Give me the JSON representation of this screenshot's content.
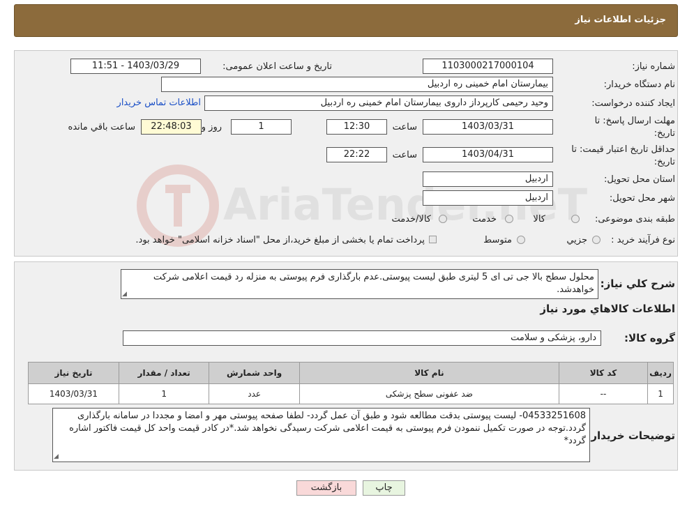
{
  "header": {
    "title": "جزئیات اطلاعات نیاز"
  },
  "need_number": {
    "label": "شماره نیاز:",
    "value": "1103000217000104"
  },
  "announce": {
    "label": "تاریخ و ساعت اعلان عمومی:",
    "value": "1403/03/29 - 11:51"
  },
  "buyer_org": {
    "label": "نام دستگاه خریدار:",
    "value": "بیمارستان امام خمینی  ره  اردبیل"
  },
  "creator": {
    "label": "ایجاد کننده درخواست:",
    "value": "وحید رحیمی کارپرداز داروی  بیمارستان امام خمینی  ره  اردبیل",
    "contact_link": "اطلاعات تماس خریدار"
  },
  "deadline": {
    "label_line1": "مهلت ارسال پاسخ: تا",
    "label_line2": "تاریخ:",
    "date": "1403/03/31",
    "time_label": "ساعت",
    "time": "12:30",
    "days": "1",
    "days_label": "روز و",
    "remaining": "22:48:03",
    "remaining_label": "ساعت باقي مانده"
  },
  "validity": {
    "label_line1": "حداقل تاریخ اعتبار قیمت: تا",
    "label_line2": "تاریخ:",
    "date": "1403/04/31",
    "time_label": "ساعت",
    "time": "22:22"
  },
  "province": {
    "label": "استان محل تحویل:",
    "value": "اردبیل"
  },
  "city": {
    "label": "شهر محل تحویل:",
    "value": "اردبیل"
  },
  "category": {
    "label": "طبقه بندی موضوعی:",
    "options": [
      "کالا",
      "خدمت",
      "کالا/خدمت"
    ]
  },
  "process": {
    "label": "نوع فرآیند خرید :",
    "options": [
      "جزیي",
      "متوسط"
    ],
    "note": "پرداخت تمام یا بخشی از مبلغ خرید،از محل \"اسناد خزانه اسلامی\" خواهد بود."
  },
  "description": {
    "label": "شرح کلي نياز:",
    "value": "محلول سطح بالا جی تی ای 5 لیتری طبق لیست پیوستی.عدم بارگذاری فرم پیوستی به منزله رد قیمت اعلامی شرکت خواهدشد."
  },
  "items_section": {
    "title": "اطلاعات کالاهاي مورد نياز"
  },
  "goods_group": {
    "label": "گروه کالا:",
    "value": "دارو، پزشکی و سلامت"
  },
  "table": {
    "headers": [
      "ردیف",
      "کد کالا",
      "نام کالا",
      "واحد شمارش",
      "تعداد / مقدار",
      "تاریخ نیاز"
    ],
    "rows": [
      [
        "1",
        "--",
        "ضد عفونی سطح پزشکی",
        "عدد",
        "1",
        "1403/03/31"
      ]
    ]
  },
  "buyer_notes": {
    "label": "توضیحات خریدار:",
    "value": "04533251608- لیست پیوستی بدقت مطالعه شود و طبق آن عمل گردد- لطفا صفحه پیوستی مهر و امضا و مجددا در سامانه بارگذاری گردد.توجه در صورت تکمیل ننمودن فرم پیوستی به قیمت اعلامی شرکت رسیدگی نخواهد شد.*در کادر قیمت واحد کل قیمت فاکتور اشاره گردد*"
  },
  "buttons": {
    "print": "چاپ",
    "back": "بازگشت"
  },
  "watermark": {
    "text": "AriaTender.neT"
  },
  "colors": {
    "header": "#8c6b3c",
    "link": "#1a4fc6",
    "highlight": "#fffbd5",
    "back_button": "#f9d9d9",
    "print_button": "#e8f5e0"
  }
}
